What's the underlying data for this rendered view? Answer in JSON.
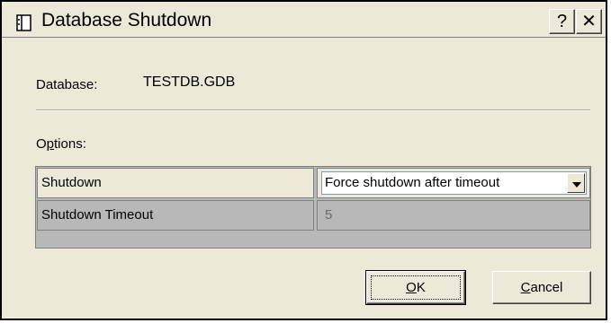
{
  "window": {
    "title": "Database Shutdown",
    "help_button": "?",
    "close_button": "✕"
  },
  "database": {
    "label": "Database:",
    "value": "TESTDB.GDB"
  },
  "options": {
    "label_accel": "p",
    "label_prefix": "O",
    "label_suffix": "tions:",
    "rows": [
      {
        "label": "Shutdown",
        "value": "Force shutdown after timeout",
        "control": "dropdown"
      },
      {
        "label": "Shutdown Timeout",
        "value": "5",
        "control": "readonly"
      }
    ]
  },
  "buttons": {
    "ok_accel": "O",
    "ok_rest": "K",
    "cancel_accel": "C",
    "cancel_rest": "ancel"
  },
  "colors": {
    "window_bg": "#ece9d8",
    "grid_bg": "#b8b8b8"
  }
}
